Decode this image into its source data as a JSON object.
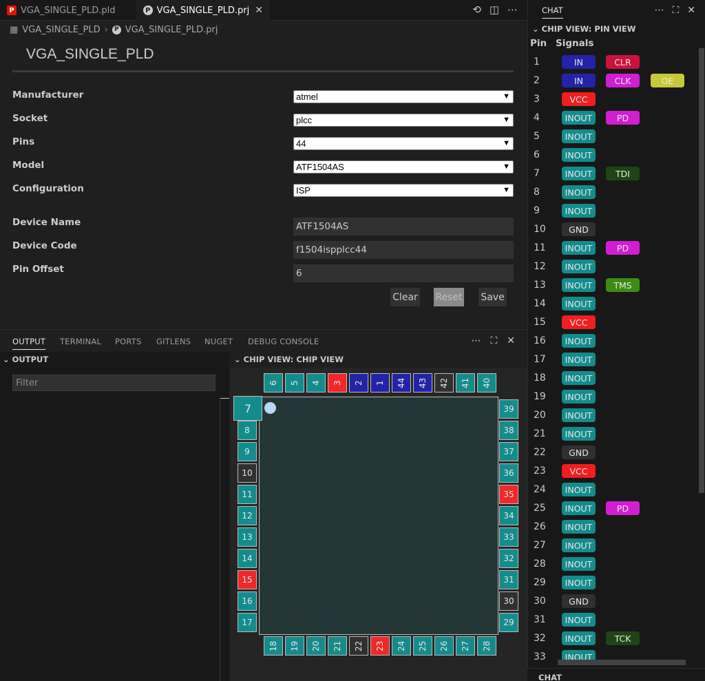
{
  "tabs": [
    {
      "label": "VGA_SINGLE_PLD.pld",
      "icon": "pld-file-icon"
    },
    {
      "label": "VGA_SINGLE_PLD.prj",
      "icon": "prj-file-icon"
    }
  ],
  "breadcrumb": {
    "folder": "VGA_SINGLE_PLD",
    "file": "VGA_SINGLE_PLD.prj"
  },
  "page_title": "VGA_SINGLE_PLD",
  "form": {
    "manufacturer": {
      "label": "Manufacturer",
      "value": "atmel"
    },
    "socket": {
      "label": "Socket",
      "value": "plcc"
    },
    "pins": {
      "label": "Pins",
      "value": "44"
    },
    "model": {
      "label": "Model",
      "value": "ATF1504AS"
    },
    "configuration": {
      "label": "Configuration",
      "value": "ISP"
    },
    "device_name": {
      "label": "Device Name",
      "value": "ATF1504AS"
    },
    "device_code": {
      "label": "Device Code",
      "value": "f1504ispplcc44"
    },
    "pin_offset": {
      "label": "Pin Offset",
      "value": "6"
    }
  },
  "buttons": {
    "clear": "Clear",
    "reset": "Reset",
    "save": "Save"
  },
  "panel_tabs": [
    "OUTPUT",
    "TERMINAL",
    "PORTS",
    "GITLENS",
    "NUGET",
    "DEBUG CONSOLE"
  ],
  "output": {
    "section": "OUTPUT",
    "filter_placeholder": "Filter"
  },
  "chip_view": {
    "section": "CHIP VIEW: CHIP VIEW",
    "top_pins": [
      "6",
      "5",
      "4",
      "3",
      "2",
      "1",
      "44",
      "43",
      "42",
      "41",
      "40"
    ],
    "left_pins": [
      "8",
      "9",
      "10",
      "11",
      "12",
      "13",
      "14",
      "15",
      "16",
      "17"
    ],
    "first_pin": "7",
    "right_pins": [
      "39",
      "38",
      "37",
      "36",
      "35",
      "34",
      "33",
      "32",
      "31",
      "30",
      "29"
    ],
    "bottom_pins": [
      "18",
      "19",
      "20",
      "21",
      "22",
      "23",
      "24",
      "25",
      "26",
      "27",
      "28"
    ]
  },
  "sidebar": {
    "tab": "CHAT",
    "section": "CHIP VIEW: PIN VIEW",
    "col_pin": "Pin",
    "col_signals": "Signals",
    "bottom_section": "CHAT"
  },
  "pin_view": [
    {
      "pin": "1",
      "signals": [
        "IN",
        "CLR"
      ]
    },
    {
      "pin": "2",
      "signals": [
        "IN",
        "CLK",
        "OE"
      ]
    },
    {
      "pin": "3",
      "signals": [
        "VCC"
      ]
    },
    {
      "pin": "4",
      "signals": [
        "INOUT",
        "PD"
      ]
    },
    {
      "pin": "5",
      "signals": [
        "INOUT"
      ]
    },
    {
      "pin": "6",
      "signals": [
        "INOUT"
      ]
    },
    {
      "pin": "7",
      "signals": [
        "INOUT",
        "TDI"
      ]
    },
    {
      "pin": "8",
      "signals": [
        "INOUT"
      ]
    },
    {
      "pin": "9",
      "signals": [
        "INOUT"
      ]
    },
    {
      "pin": "10",
      "signals": [
        "GND"
      ]
    },
    {
      "pin": "11",
      "signals": [
        "INOUT",
        "PD"
      ]
    },
    {
      "pin": "12",
      "signals": [
        "INOUT"
      ]
    },
    {
      "pin": "13",
      "signals": [
        "INOUT",
        "TMS"
      ]
    },
    {
      "pin": "14",
      "signals": [
        "INOUT"
      ]
    },
    {
      "pin": "15",
      "signals": [
        "VCC"
      ]
    },
    {
      "pin": "16",
      "signals": [
        "INOUT"
      ]
    },
    {
      "pin": "17",
      "signals": [
        "INOUT"
      ]
    },
    {
      "pin": "18",
      "signals": [
        "INOUT"
      ]
    },
    {
      "pin": "19",
      "signals": [
        "INOUT"
      ]
    },
    {
      "pin": "20",
      "signals": [
        "INOUT"
      ]
    },
    {
      "pin": "21",
      "signals": [
        "INOUT"
      ]
    },
    {
      "pin": "22",
      "signals": [
        "GND"
      ]
    },
    {
      "pin": "23",
      "signals": [
        "VCC"
      ]
    },
    {
      "pin": "24",
      "signals": [
        "INOUT"
      ]
    },
    {
      "pin": "25",
      "signals": [
        "INOUT",
        "PD"
      ]
    },
    {
      "pin": "26",
      "signals": [
        "INOUT"
      ]
    },
    {
      "pin": "27",
      "signals": [
        "INOUT"
      ]
    },
    {
      "pin": "28",
      "signals": [
        "INOUT"
      ]
    },
    {
      "pin": "29",
      "signals": [
        "INOUT"
      ]
    },
    {
      "pin": "30",
      "signals": [
        "GND"
      ]
    },
    {
      "pin": "31",
      "signals": [
        "INOUT"
      ]
    },
    {
      "pin": "32",
      "signals": [
        "INOUT",
        "TCK"
      ]
    },
    {
      "pin": "33",
      "signals": [
        "INOUT"
      ]
    }
  ],
  "signal_colors": {
    "IN": "#2323a8",
    "CLR": "#c8143c",
    "CLK": "#d21ed2",
    "OE": "#c8c83c",
    "VCC": "#f01e1e",
    "INOUT": "#148c8c",
    "PD": "#d21ed2",
    "TDI": "#1e4614",
    "GND": "#303030",
    "TMS": "#3c8c14",
    "TCK": "#1e4614"
  },
  "pin_type_colors": {
    "io": "#148c8c",
    "vcc": "#f02828",
    "gnd": "#303030",
    "in": "#2323a8"
  },
  "chip_pin_types": {
    "1": "in",
    "2": "in",
    "3": "vcc",
    "10": "gnd",
    "15": "vcc",
    "22": "gnd",
    "23": "vcc",
    "30": "gnd",
    "35": "vcc",
    "42": "gnd",
    "43": "in",
    "44": "in"
  }
}
